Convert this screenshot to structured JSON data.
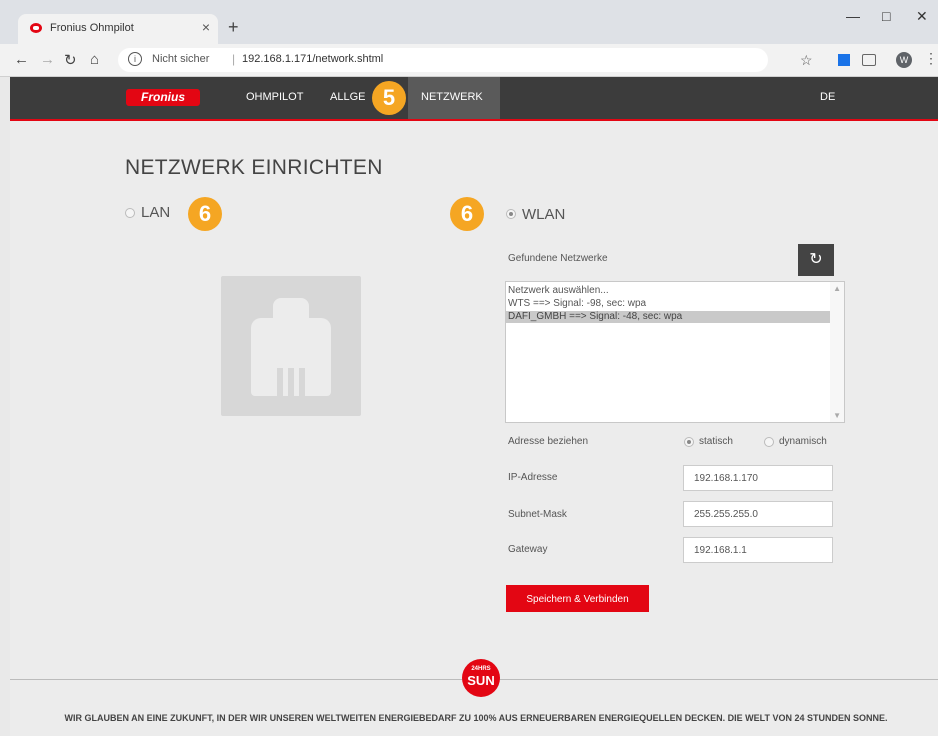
{
  "browser": {
    "tab_title": "Fronius Ohmpilot",
    "tab_close": "×",
    "new_tab": "+",
    "security_label": "Nicht sicher",
    "url": "192.168.1.171/network.shtml",
    "avatar_letter": "W"
  },
  "header": {
    "logo_text": "Fronius",
    "nav": {
      "ohmpilot": "OHMPILOT",
      "allgemein": "ALLGE",
      "netzwerk": "NETZWERK"
    },
    "language": "DE",
    "nav_active_color": "#5a5a5a"
  },
  "page": {
    "title": "NETZWERK EINRICHTEN",
    "lan_label": "LAN",
    "wlan_label": "WLAN",
    "badges": {
      "nav": "5",
      "lan": "6",
      "wlan": "6"
    },
    "found_networks_label": "Gefundene Netzwerke",
    "networks": [
      {
        "label": "Netzwerk auswählen...",
        "selected": false
      },
      {
        "label": "WTS ==> Signal: -98, sec: wpa",
        "selected": false
      },
      {
        "label": "DAFI_GMBH ==> Signal: -48, sec: wpa",
        "selected": true
      }
    ],
    "address_label": "Adresse beziehen",
    "option_static": "statisch",
    "option_dynamic": "dynamisch",
    "ip_label": "IP-Adresse",
    "ip_value": "192.168.1.170",
    "subnet_label": "Subnet-Mask",
    "subnet_value": "255.255.255.0",
    "gateway_label": "Gateway",
    "gateway_value": "192.168.1.1",
    "save_button": "Speichern & Verbinden"
  },
  "footer": {
    "logo_small": "24HRS",
    "logo_big": "SUN",
    "text": "WIR GLAUBEN AN EINE ZUKUNFT, IN DER WIR UNSEREN WELTWEITEN ENERGIEBEDARF ZU 100% AUS ERNEUERBAREN ENERGIEQUELLEN DECKEN. DIE WELT VON 24 STUNDEN SONNE."
  },
  "colors": {
    "brand_red": "#e30613",
    "badge_orange": "#f5a623",
    "header_bg": "#3c3c3c"
  }
}
